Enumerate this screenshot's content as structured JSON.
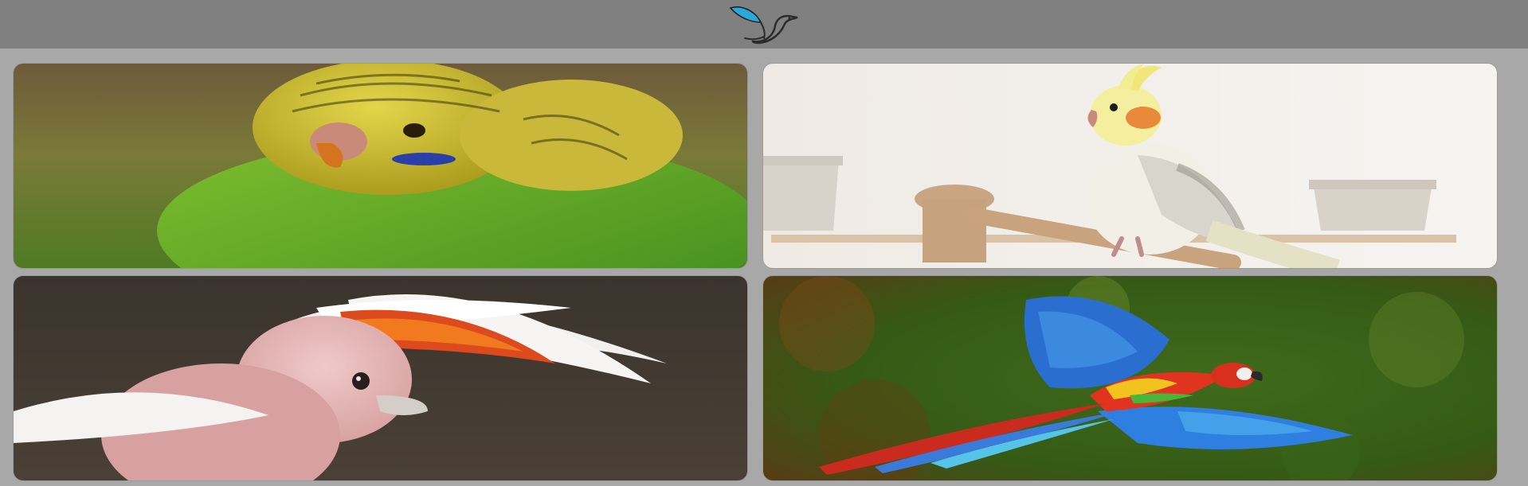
{
  "header": {
    "logo_icon": "hummingbird-logo-icon",
    "accent_color": "#29a9d8",
    "bar_color": "#808080"
  },
  "gallery": {
    "background_color": "#a8a8a8",
    "cards": [
      {
        "subject": "budgie",
        "icon": "yellow-green-parakeet-image"
      },
      {
        "subject": "cockatiel",
        "icon": "cockatiel-on-perch-image"
      },
      {
        "subject": "cockatoo",
        "icon": "pink-cockatoo-crest-image"
      },
      {
        "subject": "macaw",
        "icon": "flying-scarlet-macaw-image"
      }
    ]
  }
}
